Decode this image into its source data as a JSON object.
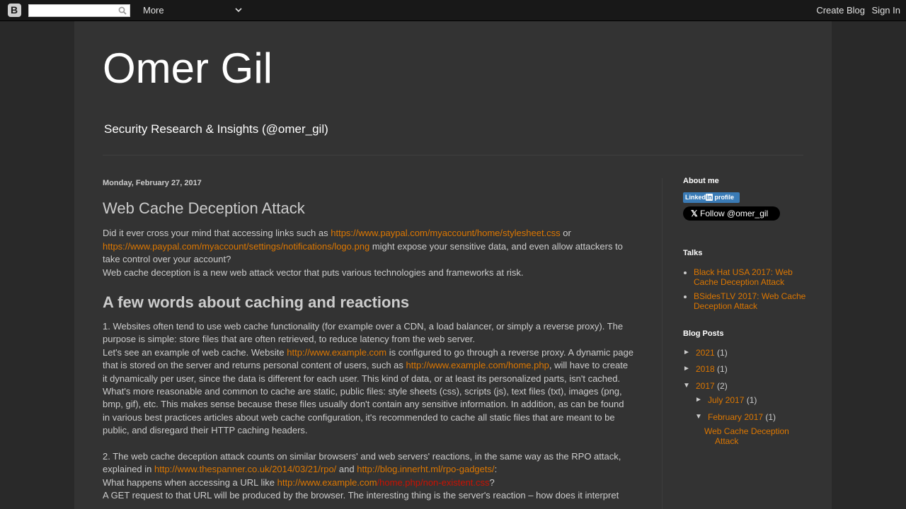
{
  "navbar": {
    "logo": "B",
    "search_placeholder": "",
    "more_label": "More",
    "create_blog": "Create Blog",
    "sign_in": "Sign In"
  },
  "blog": {
    "title": "Omer Gil",
    "description": "Security Research & Insights (@omer_gil)"
  },
  "post": {
    "date": "Monday, February 27, 2017",
    "title": "Web Cache Deception Attack",
    "intro": {
      "t1": "Did it ever cross your mind that accessing links such as ",
      "link1": "https://www.paypal.com/myaccount/home/stylesheet.css",
      "t2": " or ",
      "link2": "https://www.paypal.com/myaccount/settings/notifications/logo.png",
      "t3": " might expose your sensitive data, and even allow attackers to take control over your account?",
      "t4": "Web cache deception is a new web attack vector that puts various technologies and frameworks at risk."
    },
    "section_heading": "A few words about caching and reactions",
    "p1": {
      "t1": "1. Websites often tend to use web cache functionality (for example over a CDN, a load balancer, or simply a reverse proxy). The purpose is simple: store files that are often retrieved, to reduce latency from the web server.",
      "t2": "Let's see an example of web cache. Website ",
      "link1": "http://www.example.com",
      "t3": " is configured to go through a reverse proxy. A dynamic page that is stored on the server and returns personal content of users, such as ",
      "link2": "http://www.example.com/home.php",
      "t4": ", will have to create it dynamically per user, since the data is different for each user. This kind of data, or at least its personalized parts, isn't cached.",
      "t5": "What's more reasonable and common to cache are static, public files: style sheets (css), scripts (js), text files (txt), images (png, bmp, gif), etc. This makes sense because these files usually don't contain any sensitive information. In addition, as can be found in various best practices articles about web cache configuration, it's recommended to cache all static files that are meant to be public, and disregard their HTTP caching headers."
    },
    "p2": {
      "t1": "2. The web cache deception attack counts on similar browsers' and web servers' reactions, in the same way as the RPO attack, explained in ",
      "link1": "http://www.thespanner.co.uk/2014/03/21/rpo/",
      "t2": " and ",
      "link2": "http://blog.innerht.ml/rpo-gadgets/",
      "t3": ":",
      "t4": "What happens when accessing a URL like ",
      "link3a": "http://www.example.com",
      "link3b": "/home.php/non-existent.css",
      "t5": "?",
      "t6": "A GET request to that URL will be produced by the browser. The interesting thing is the server's reaction – how does it interpret"
    }
  },
  "sidebar": {
    "about_heading": "About me",
    "linkedin_label_a": "Linked",
    "linkedin_label_b": "in",
    "linkedin_label_c": " profile",
    "twitter_label": "Follow @omer_gil",
    "talks_heading": "Talks",
    "talks": [
      "Black Hat USA 2017: Web Cache Deception Attack",
      "BSidesTLV 2017: Web Cache Deception Attack"
    ],
    "blogposts_heading": "Blog Posts",
    "archive": {
      "y2021": {
        "label": "2021",
        "count": "(1)"
      },
      "y2018": {
        "label": "2018",
        "count": "(1)"
      },
      "y2017": {
        "label": "2017",
        "count": "(2)"
      },
      "jul2017": {
        "label": "July 2017",
        "count": "(1)"
      },
      "feb2017": {
        "label": "February 2017",
        "count": "(1)"
      },
      "post": "Web Cache Deception Attack"
    },
    "triangles": {
      "collapsed": "►",
      "expanded": "▼"
    }
  },
  "colors": {
    "link": "#dd7700",
    "link_visited": "#cc1100",
    "background": "#292929",
    "panel": "#333333"
  }
}
